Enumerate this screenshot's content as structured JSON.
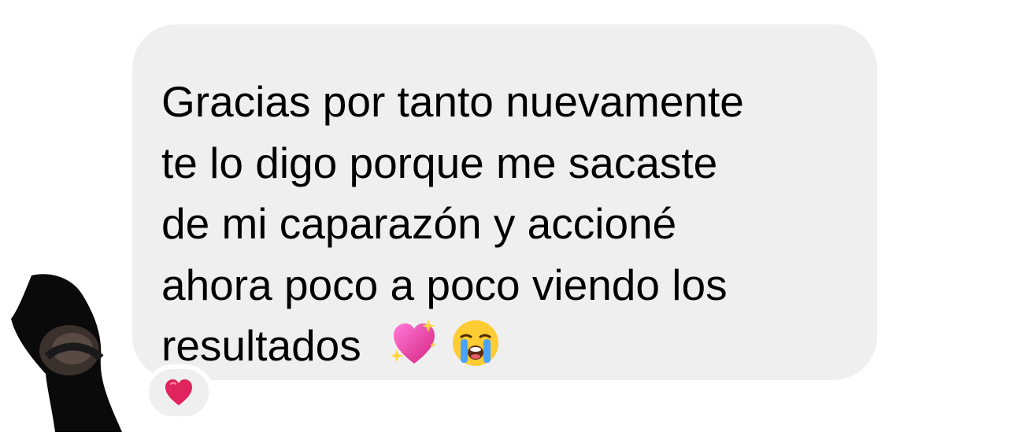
{
  "message": {
    "lines": [
      "Gracias por tanto nuevamente",
      "te lo digo porque me sacaste",
      "de mi caparazón y accioné",
      "ahora poco a poco viendo los",
      "resultados"
    ],
    "emojis": [
      "sparkling-heart-icon",
      "loudly-crying-face-icon"
    ]
  },
  "reaction": {
    "emoji": "red-heart-icon"
  },
  "colors": {
    "bubble": "#efefef",
    "text": "#000000",
    "heart": "#e0245e"
  }
}
